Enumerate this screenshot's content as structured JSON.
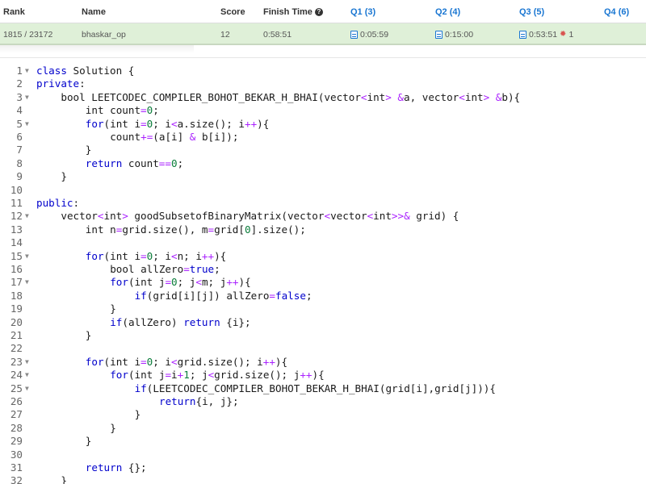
{
  "ranking": {
    "headers": {
      "rank": "Rank",
      "name": "Name",
      "score": "Score",
      "finish_time": "Finish Time",
      "q1": "Q1 (3)",
      "q2": "Q2 (4)",
      "q3": "Q3 (5)",
      "q4": "Q4 (6)"
    },
    "row": {
      "rank": "1815 / 23172",
      "name": "bhaskar_op",
      "score": "12",
      "finish_time": "0:58:51",
      "q1": "0:05:59",
      "q2": "0:15:00",
      "q3": "0:53:51",
      "q3_penalty": "1",
      "q4": ""
    }
  },
  "editor": {
    "lines": [
      {
        "n": "1",
        "fold": true,
        "indent": 0,
        "tokens": [
          [
            "kw",
            "class"
          ],
          [
            "p",
            " Solution {"
          ]
        ]
      },
      {
        "n": "2",
        "fold": false,
        "indent": 0,
        "tokens": [
          [
            "kw",
            "private"
          ],
          [
            "p",
            ":"
          ]
        ]
      },
      {
        "n": "3",
        "fold": true,
        "indent": 4,
        "tokens": [
          [
            "p",
            "bool LEETCODEC_COMPILER_BOHOT_BEKAR_H_BHAI(vector"
          ],
          [
            "op",
            "<"
          ],
          [
            "p",
            "int"
          ],
          [
            "op",
            "> &"
          ],
          [
            "p",
            "a, vector"
          ],
          [
            "op",
            "<"
          ],
          [
            "p",
            "int"
          ],
          [
            "op",
            "> &"
          ],
          [
            "p",
            "b){"
          ]
        ]
      },
      {
        "n": "4",
        "fold": false,
        "indent": 8,
        "tokens": [
          [
            "p",
            "int count"
          ],
          [
            "op",
            "="
          ],
          [
            "num",
            "0"
          ],
          [
            "p",
            ";"
          ]
        ]
      },
      {
        "n": "5",
        "fold": true,
        "indent": 8,
        "tokens": [
          [
            "kw",
            "for"
          ],
          [
            "p",
            "(int i"
          ],
          [
            "op",
            "="
          ],
          [
            "num",
            "0"
          ],
          [
            "p",
            "; i"
          ],
          [
            "op",
            "<"
          ],
          [
            "p",
            "a.size(); i"
          ],
          [
            "op",
            "++"
          ],
          [
            "p",
            "){"
          ]
        ]
      },
      {
        "n": "6",
        "fold": false,
        "indent": 12,
        "tokens": [
          [
            "p",
            "count"
          ],
          [
            "op",
            "+="
          ],
          [
            "p",
            "(a[i] "
          ],
          [
            "op",
            "&"
          ],
          [
            "p",
            " b[i]);"
          ]
        ]
      },
      {
        "n": "7",
        "fold": false,
        "indent": 8,
        "tokens": [
          [
            "p",
            "}"
          ]
        ]
      },
      {
        "n": "8",
        "fold": false,
        "indent": 8,
        "tokens": [
          [
            "kw",
            "return"
          ],
          [
            "p",
            " count"
          ],
          [
            "op",
            "=="
          ],
          [
            "num",
            "0"
          ],
          [
            "p",
            ";"
          ]
        ]
      },
      {
        "n": "9",
        "fold": false,
        "indent": 4,
        "tokens": [
          [
            "p",
            "}"
          ]
        ]
      },
      {
        "n": "10",
        "fold": false,
        "indent": 0,
        "tokens": []
      },
      {
        "n": "11",
        "fold": false,
        "indent": 0,
        "tokens": [
          [
            "kw",
            "public"
          ],
          [
            "p",
            ":"
          ]
        ]
      },
      {
        "n": "12",
        "fold": true,
        "indent": 4,
        "tokens": [
          [
            "p",
            "vector"
          ],
          [
            "op",
            "<"
          ],
          [
            "p",
            "int"
          ],
          [
            "op",
            ">"
          ],
          [
            "p",
            " goodSubsetofBinaryMatrix(vector"
          ],
          [
            "op",
            "<"
          ],
          [
            "p",
            "vector"
          ],
          [
            "op",
            "<"
          ],
          [
            "p",
            "int"
          ],
          [
            "op",
            ">>&"
          ],
          [
            "p",
            " grid) {"
          ]
        ]
      },
      {
        "n": "13",
        "fold": false,
        "indent": 8,
        "tokens": [
          [
            "p",
            "int n"
          ],
          [
            "op",
            "="
          ],
          [
            "p",
            "grid.size(), m"
          ],
          [
            "op",
            "="
          ],
          [
            "p",
            "grid["
          ],
          [
            "num",
            "0"
          ],
          [
            "p",
            "].size();"
          ]
        ]
      },
      {
        "n": "14",
        "fold": false,
        "indent": 0,
        "tokens": []
      },
      {
        "n": "15",
        "fold": true,
        "indent": 8,
        "tokens": [
          [
            "kw",
            "for"
          ],
          [
            "p",
            "(int i"
          ],
          [
            "op",
            "="
          ],
          [
            "num",
            "0"
          ],
          [
            "p",
            "; i"
          ],
          [
            "op",
            "<"
          ],
          [
            "p",
            "n; i"
          ],
          [
            "op",
            "++"
          ],
          [
            "p",
            "){"
          ]
        ]
      },
      {
        "n": "16",
        "fold": false,
        "indent": 12,
        "tokens": [
          [
            "p",
            "bool allZero"
          ],
          [
            "op",
            "="
          ],
          [
            "kw",
            "true"
          ],
          [
            "p",
            ";"
          ]
        ]
      },
      {
        "n": "17",
        "fold": true,
        "indent": 12,
        "tokens": [
          [
            "kw",
            "for"
          ],
          [
            "p",
            "(int j"
          ],
          [
            "op",
            "="
          ],
          [
            "num",
            "0"
          ],
          [
            "p",
            "; j"
          ],
          [
            "op",
            "<"
          ],
          [
            "p",
            "m; j"
          ],
          [
            "op",
            "++"
          ],
          [
            "p",
            "){"
          ]
        ]
      },
      {
        "n": "18",
        "fold": false,
        "indent": 16,
        "tokens": [
          [
            "kw",
            "if"
          ],
          [
            "p",
            "(grid[i][j]) allZero"
          ],
          [
            "op",
            "="
          ],
          [
            "kw",
            "false"
          ],
          [
            "p",
            ";"
          ]
        ]
      },
      {
        "n": "19",
        "fold": false,
        "indent": 12,
        "tokens": [
          [
            "p",
            "}"
          ]
        ]
      },
      {
        "n": "20",
        "fold": false,
        "indent": 12,
        "tokens": [
          [
            "kw",
            "if"
          ],
          [
            "p",
            "(allZero) "
          ],
          [
            "kw",
            "return"
          ],
          [
            "p",
            " {i};"
          ]
        ]
      },
      {
        "n": "21",
        "fold": false,
        "indent": 8,
        "tokens": [
          [
            "p",
            "}"
          ]
        ]
      },
      {
        "n": "22",
        "fold": false,
        "indent": 0,
        "tokens": []
      },
      {
        "n": "23",
        "fold": true,
        "indent": 8,
        "tokens": [
          [
            "kw",
            "for"
          ],
          [
            "p",
            "(int i"
          ],
          [
            "op",
            "="
          ],
          [
            "num",
            "0"
          ],
          [
            "p",
            "; i"
          ],
          [
            "op",
            "<"
          ],
          [
            "p",
            "grid.size(); i"
          ],
          [
            "op",
            "++"
          ],
          [
            "p",
            "){"
          ]
        ]
      },
      {
        "n": "24",
        "fold": true,
        "indent": 12,
        "tokens": [
          [
            "kw",
            "for"
          ],
          [
            "p",
            "(int j"
          ],
          [
            "op",
            "="
          ],
          [
            "p",
            "i"
          ],
          [
            "op",
            "+"
          ],
          [
            "num",
            "1"
          ],
          [
            "p",
            "; j"
          ],
          [
            "op",
            "<"
          ],
          [
            "p",
            "grid.size(); j"
          ],
          [
            "op",
            "++"
          ],
          [
            "p",
            "){"
          ]
        ]
      },
      {
        "n": "25",
        "fold": true,
        "indent": 16,
        "tokens": [
          [
            "kw",
            "if"
          ],
          [
            "p",
            "(LEETCODEC_COMPILER_BOHOT_BEKAR_H_BHAI(grid[i],grid[j])){"
          ]
        ]
      },
      {
        "n": "26",
        "fold": false,
        "indent": 20,
        "tokens": [
          [
            "kw",
            "return"
          ],
          [
            "p",
            "{i, j};"
          ]
        ]
      },
      {
        "n": "27",
        "fold": false,
        "indent": 16,
        "tokens": [
          [
            "p",
            "}"
          ]
        ]
      },
      {
        "n": "28",
        "fold": false,
        "indent": 12,
        "tokens": [
          [
            "p",
            "}"
          ]
        ]
      },
      {
        "n": "29",
        "fold": false,
        "indent": 8,
        "tokens": [
          [
            "p",
            "}"
          ]
        ]
      },
      {
        "n": "30",
        "fold": false,
        "indent": 0,
        "tokens": []
      },
      {
        "n": "31",
        "fold": false,
        "indent": 8,
        "tokens": [
          [
            "kw",
            "return"
          ],
          [
            "p",
            " {};"
          ]
        ]
      },
      {
        "n": "32",
        "fold": false,
        "indent": 4,
        "tokens": [
          [
            "p",
            "}"
          ]
        ]
      }
    ]
  },
  "icons": {
    "help": "question-circle-icon",
    "submission": "document-icon",
    "penalty": "bug-icon"
  },
  "colors": {
    "accent": "#1976d2",
    "row_highlight": "#dff0d8",
    "penalty": "#d9534f",
    "keyword": "#0000cc",
    "operator": "#aa22ff",
    "number": "#0a7c3a"
  }
}
